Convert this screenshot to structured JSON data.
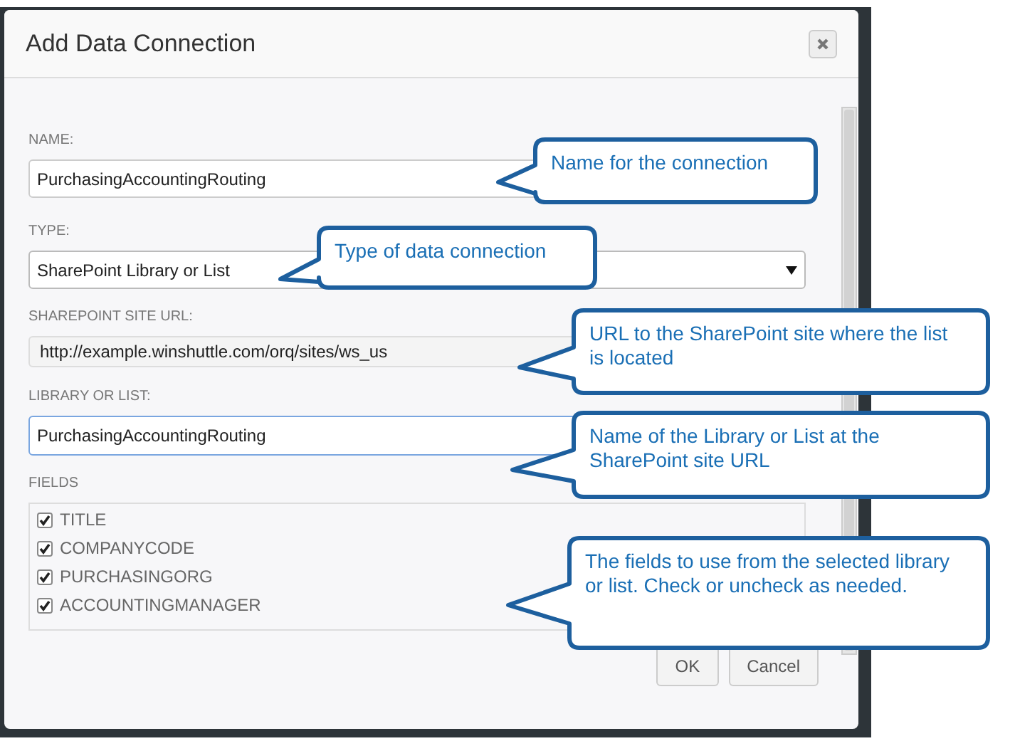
{
  "dialog": {
    "title": "Add Data Connection",
    "name": {
      "label": "NAME:",
      "value": "PurchasingAccountingRouting"
    },
    "type": {
      "label": "TYPE:",
      "value": "SharePoint Library or List"
    },
    "site_url": {
      "label": "SHAREPOINT SITE URL:",
      "value": "http://example.winshuttle.com/orq/sites/ws_us"
    },
    "library": {
      "label": "LIBRARY OR LIST:",
      "value": "PurchasingAccountingRouting",
      "focused": true
    },
    "fields": {
      "label": "FIELDS",
      "items": [
        {
          "label": "TITLE",
          "checked": true
        },
        {
          "label": "COMPANYCODE",
          "checked": true
        },
        {
          "label": "PURCHASINGORG",
          "checked": true
        },
        {
          "label": "ACCOUNTINGMANAGER",
          "checked": true
        }
      ]
    },
    "buttons": [
      "OK",
      "Cancel"
    ]
  },
  "callouts": [
    {
      "text": "Name for the connection"
    },
    {
      "text": "Type of data connection"
    },
    {
      "text": "URL to the SharePoint site where the list is located"
    },
    {
      "text": "Name of the Library or List at the SharePoint site URL"
    },
    {
      "text": "The fields to use from the selected library or list. Check or uncheck as needed."
    }
  ]
}
